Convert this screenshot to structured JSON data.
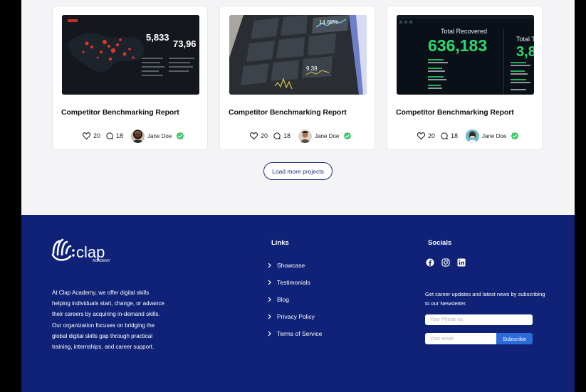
{
  "projects": [
    {
      "image_icon": "world-map-dashboard",
      "image_text": {
        "big": "5,833",
        "big2": "73,96"
      },
      "title": "Competitor Benchmarking Report",
      "likes": "20",
      "comments": "18",
      "author": "Jane Doe"
    },
    {
      "image_icon": "tablet-dashboard",
      "image_text": {
        "big": "14.65%",
        "big2": "9.38"
      },
      "title": "Competitor Benchmarking Report",
      "likes": "20",
      "comments": "18",
      "author": "Jane Doe"
    },
    {
      "image_icon": "recovered-stats-dashboard",
      "image_text": {
        "label": "Total Recovered",
        "big": "636,183",
        "label2": "Total T",
        "big2": "3,8"
      },
      "title": "Competitor Benchmarking Report",
      "likes": "20",
      "comments": "18",
      "author": "Jane Doe"
    }
  ],
  "load_more_label": "Load more projects",
  "footer": {
    "logo_text": "clap",
    "logo_sub": "ACADEMY",
    "about": "At Clap Academy, we offer digital skills helping individuals start, change, or advance their careers by acquiring in-demand skills. Our organization focuses on bridging the global digital skills gap through practical training, internships, and career support.",
    "links_heading": "Links",
    "links": [
      "Showcase",
      "Testimonials",
      "Blog",
      "Privacy Policy",
      "Terms of Service"
    ],
    "socials_heading": "Socials",
    "socials": [
      "facebook-icon",
      "instagram-icon",
      "linkedin-icon"
    ],
    "newsletter_text": "Get career updates and latest news by subscribing to our Newsletter.",
    "phone_placeholder": "Your Phone no.",
    "email_placeholder": "Your email",
    "subscribe_label": "Subscribe"
  },
  "colors": {
    "footer_bg": "#0f2277",
    "accent": "#2d6bd9",
    "verified": "#3ec96b",
    "button_border": "#1d2d7a"
  }
}
